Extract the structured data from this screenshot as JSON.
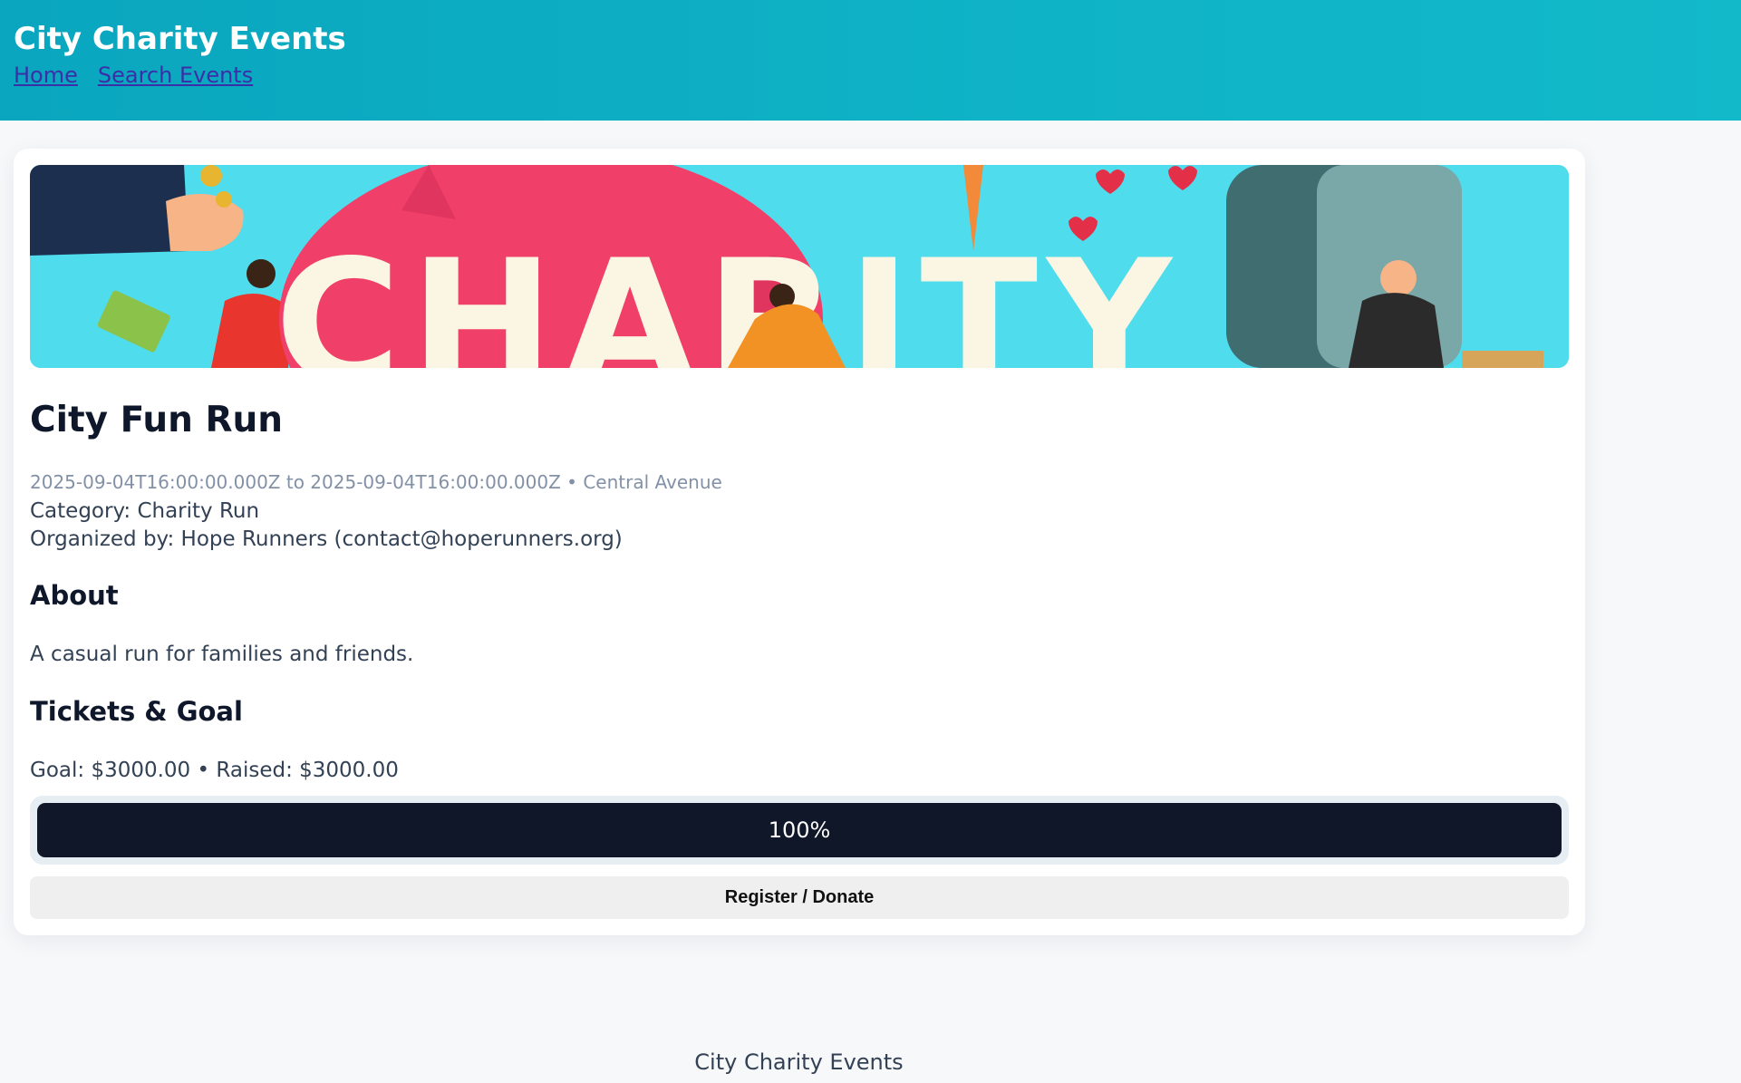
{
  "header": {
    "title": "City Charity Events",
    "nav": [
      {
        "label": "Home"
      },
      {
        "label": "Search Events"
      }
    ]
  },
  "event": {
    "banner_icon": "charity-banner-illustration",
    "title": "City Fun Run",
    "meta": "2025-09-04T16:00:00.000Z to 2025-09-04T16:00:00.000Z • Central Avenue",
    "category": "Category: Charity Run",
    "organizer": "Organized by: Hope Runners (contact@hoperunners.org)",
    "about_heading": "About",
    "about_text": "A casual run for families and friends.",
    "tickets_heading": "Tickets & Goal",
    "goal_text": "Goal: $3000.00 • Raised: $3000.00",
    "progress_fraction": 1.0,
    "progress_label": "100%",
    "register_label": "Register / Donate"
  },
  "footer": {
    "text": "City Charity Events"
  },
  "colors": {
    "header_bg": "#0fb3c6",
    "progress_fill": "#101728",
    "banner_bg": "#4fdced"
  }
}
